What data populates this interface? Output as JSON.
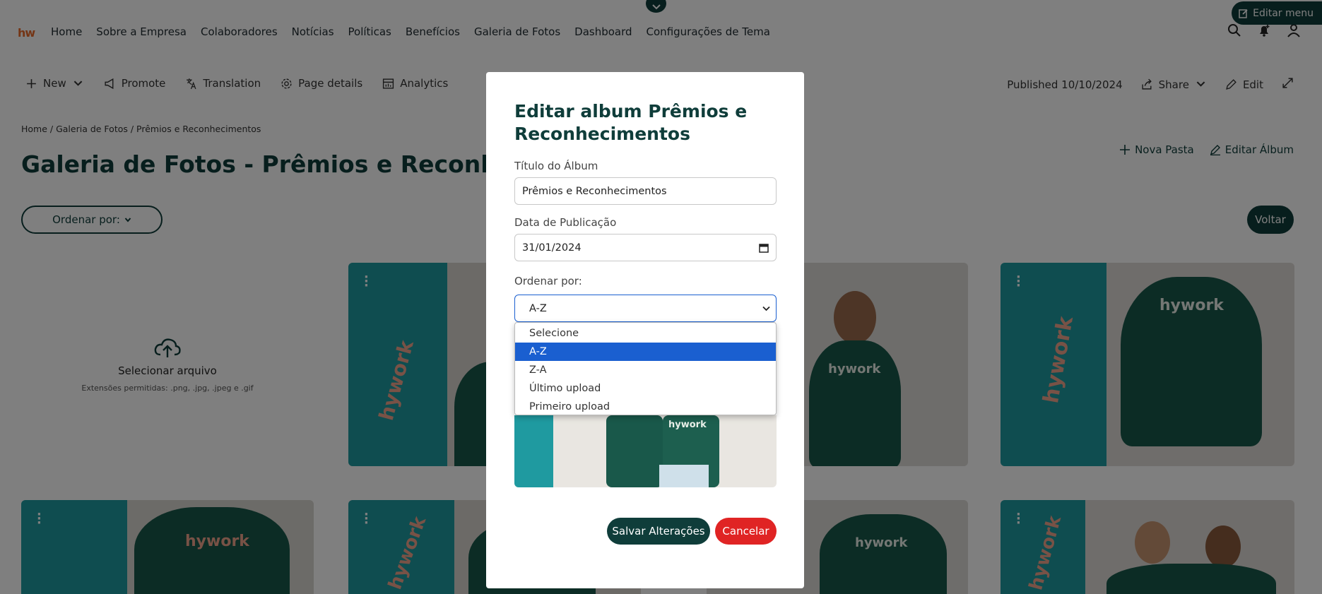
{
  "topnav": {
    "logo": "hw",
    "links": [
      "Home",
      "Sobre a Empresa",
      "Colaboradores",
      "Notícias",
      "Políticas",
      "Benefícios",
      "Galeria de Fotos",
      "Dashboard",
      "Configurações de Tema"
    ],
    "edit_menu": "Editar menu"
  },
  "cmdbar": {
    "new": "New",
    "promote": "Promote",
    "translation": "Translation",
    "page_details": "Page details",
    "analytics": "Analytics",
    "published": "Published 10/10/2024",
    "share": "Share",
    "edit": "Edit"
  },
  "page": {
    "breadcrumb": "Home / Galeria de Fotos / Prêmios e Reconhecimentos",
    "title": "Galeria de Fotos - Prêmios e Reconhecimentos",
    "new_folder": "Nova Pasta",
    "edit_album": "Editar Álbum",
    "order_button": "Ordenar por:",
    "back_button": "Voltar",
    "upload_title": "Selecionar arquivo",
    "upload_subtitle": "Extensões permitidas: .png, .jpg, .jpeg e .gif",
    "photo_brand": "hywork"
  },
  "modal": {
    "title": "Editar album Prêmios e Reconhecimentos",
    "album_title_label": "Título do Álbum",
    "album_title_value": "Prêmios e Reconhecimentos",
    "date_label": "Data de Publicação",
    "date_value": "31/01/2024",
    "order_label": "Ordenar por:",
    "order_value": "A-Z",
    "order_options": [
      "Selecione",
      "A-Z",
      "Z-A",
      "Último upload",
      "Primeiro upload"
    ],
    "save_button": "Salvar Alterações",
    "cancel_button": "Cancelar"
  },
  "colors": {
    "brand_dark": "#0f3d3a",
    "accent_teal": "#1f9aa0",
    "danger": "#e02424",
    "selection": "#1a5fd0"
  }
}
